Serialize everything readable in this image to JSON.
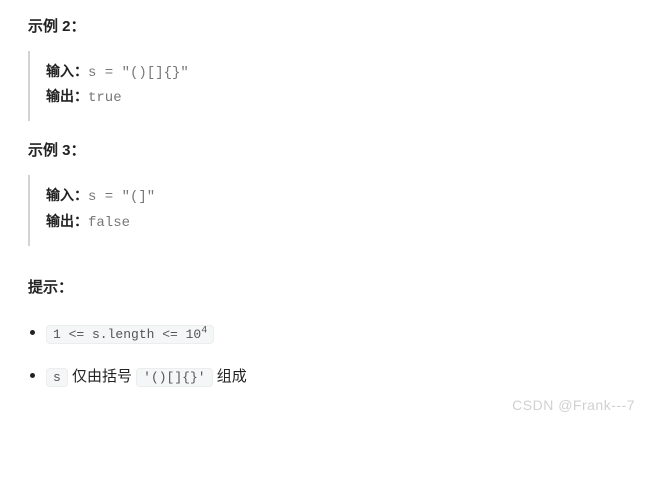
{
  "example2": {
    "heading": "示例 2：",
    "input_label": "输入：",
    "input_value": "s = \"()[]{}\"",
    "output_label": "输出：",
    "output_value": "true"
  },
  "example3": {
    "heading": "示例 3：",
    "input_label": "输入：",
    "input_value": "s = \"(]\"",
    "output_label": "输出：",
    "output_value": "false"
  },
  "tips": {
    "heading": "提示：",
    "item1": {
      "code": "1 <= s.length <= 10",
      "sup": "4"
    },
    "item2": {
      "prefix_code": "s",
      "mid_text": " 仅由括号 ",
      "code2": "'()[]{}'",
      "suffix_text": " 组成"
    }
  },
  "watermark_bottom": "CSDN @Frank---7",
  "watermark_top": ""
}
